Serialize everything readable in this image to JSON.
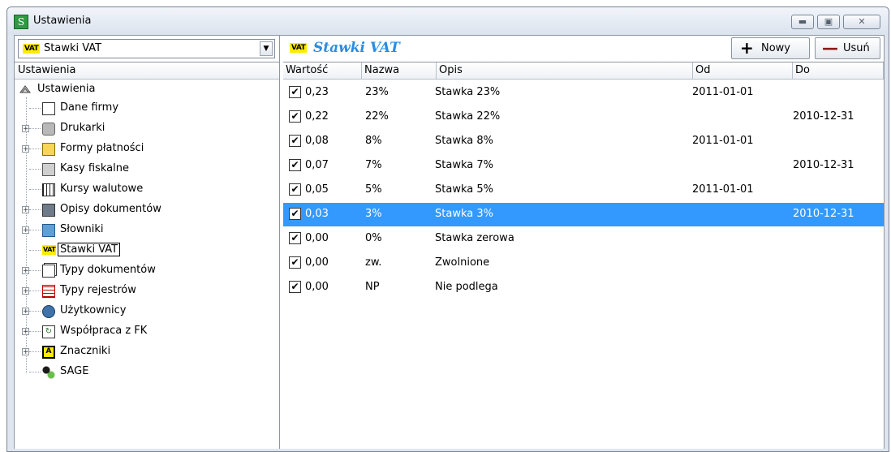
{
  "window": {
    "title": "Ustawienia",
    "app_icon_letter": "S"
  },
  "left": {
    "combo_text": "Stawki VAT",
    "vat_badge": "VAT",
    "header": "Ustawienia",
    "tree_root": "Ustawienia",
    "tree_items": [
      {
        "label": "Dane firmy",
        "icon": "document-icon",
        "expandable": false
      },
      {
        "label": "Drukarki",
        "icon": "printer-icon",
        "expandable": true
      },
      {
        "label": "Formy płatności",
        "icon": "payment-card-icon",
        "expandable": true
      },
      {
        "label": "Kasy fiskalne",
        "icon": "cash-register-icon",
        "expandable": false
      },
      {
        "label": "Kursy walutowe",
        "icon": "table-grid-icon",
        "expandable": false
      },
      {
        "label": "Opisy dokumentów",
        "icon": "floppy-disk-icon",
        "expandable": true
      },
      {
        "label": "Słowniki",
        "icon": "book-icon",
        "expandable": true
      },
      {
        "label": "Stawki VAT",
        "icon": "vat-badge-icon",
        "expandable": false,
        "selected": true
      },
      {
        "label": "Typy dokumentów",
        "icon": "documents-icon",
        "expandable": true
      },
      {
        "label": "Typy rejestrów",
        "icon": "register-table-icon",
        "expandable": true
      },
      {
        "label": "Użytkownicy",
        "icon": "users-icon",
        "expandable": true
      },
      {
        "label": "Współpraca z FK",
        "icon": "sync-icon",
        "expandable": true
      },
      {
        "label": "Znaczniki",
        "icon": "tag-icon",
        "expandable": true
      },
      {
        "label": "SAGE",
        "icon": "sage-icon",
        "expandable": false
      }
    ]
  },
  "right": {
    "vat_badge": "VAT",
    "title": "Stawki VAT",
    "new_button": "Nowy",
    "delete_button": "Usuń",
    "columns": [
      "Wartość",
      "Nazwa",
      "Opis",
      "Od",
      "Do"
    ],
    "rows": [
      {
        "checked": true,
        "value": "0,23",
        "name": "23%",
        "desc": "Stawka 23%",
        "from": "2011-01-01",
        "to": ""
      },
      {
        "checked": true,
        "value": "0,22",
        "name": "22%",
        "desc": "Stawka 22%",
        "from": "",
        "to": "2010-12-31"
      },
      {
        "checked": true,
        "value": "0,08",
        "name": "8%",
        "desc": "Stawka 8%",
        "from": "2011-01-01",
        "to": ""
      },
      {
        "checked": true,
        "value": "0,07",
        "name": "7%",
        "desc": "Stawka 7%",
        "from": "",
        "to": "2010-12-31"
      },
      {
        "checked": true,
        "value": "0,05",
        "name": "5%",
        "desc": "Stawka 5%",
        "from": "2011-01-01",
        "to": ""
      },
      {
        "checked": true,
        "value": "0,03",
        "name": "3%",
        "desc": "Stawka 3%",
        "from": "",
        "to": "2010-12-31",
        "selected": true
      },
      {
        "checked": true,
        "value": "0,00",
        "name": "0%",
        "desc": "Stawka zerowa",
        "from": "",
        "to": ""
      },
      {
        "checked": true,
        "value": "0,00",
        "name": "zw.",
        "desc": "Zwolnione",
        "from": "",
        "to": ""
      },
      {
        "checked": true,
        "value": "0,00",
        "name": "NP",
        "desc": "Nie podlega",
        "from": "",
        "to": ""
      }
    ]
  },
  "colors": {
    "selection": "#3399ff",
    "title_accent": "#2a8ce2",
    "vat_badge_bg": "#ffeb00"
  }
}
